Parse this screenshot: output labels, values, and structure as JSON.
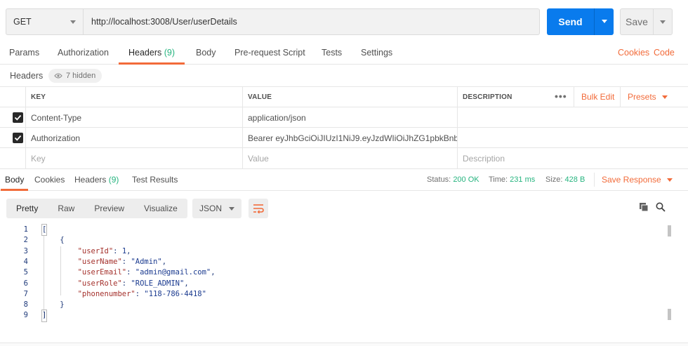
{
  "request": {
    "method": "GET",
    "url": "http://localhost:3008/User/userDetails",
    "send_label": "Send",
    "save_label": "Save"
  },
  "request_tabs": [
    {
      "label": "Params"
    },
    {
      "label": "Authorization"
    },
    {
      "label": "Headers",
      "count": "(9)"
    },
    {
      "label": "Body"
    },
    {
      "label": "Pre-request Script"
    },
    {
      "label": "Tests"
    },
    {
      "label": "Settings"
    }
  ],
  "right_links": {
    "cookies": "Cookies",
    "code": "Code"
  },
  "headers_bar": {
    "title": "Headers",
    "hidden": "7 hidden"
  },
  "table": {
    "columns": {
      "key": "KEY",
      "value": "VALUE",
      "description": "DESCRIPTION"
    },
    "dots": "•••",
    "bulk_edit": "Bulk Edit",
    "presets": "Presets",
    "rows": [
      {
        "key": "Content-Type",
        "value": "application/json",
        "description": ""
      },
      {
        "key": "Authorization",
        "value": "Bearer eyJhbGciOiJIUzI1NiJ9.eyJzdWIiOiJhZG1pbkBnb\\...",
        "description": ""
      }
    ],
    "placeholders": {
      "key": "Key",
      "value": "Value",
      "description": "Description"
    }
  },
  "response_tabs": [
    {
      "label": "Body"
    },
    {
      "label": "Cookies"
    },
    {
      "label": "Headers",
      "count": "(9)"
    },
    {
      "label": "Test Results"
    }
  ],
  "response_status": {
    "status_label": "Status:",
    "status_value": "200 OK",
    "time_label": "Time:",
    "time_value": "231 ms",
    "size_label": "Size:",
    "size_value": "428 B",
    "save_response": "Save Response"
  },
  "view_modes": [
    "Pretty",
    "Raw",
    "Preview",
    "Visualize"
  ],
  "format": "JSON",
  "code_lines": [
    {
      "n": "1",
      "text": "["
    },
    {
      "n": "2",
      "text": "    {"
    },
    {
      "n": "3",
      "key": "\"userId\"",
      "val": "1",
      "type": "n"
    },
    {
      "n": "4",
      "key": "\"userName\"",
      "val": "\"Admin\"",
      "type": "s"
    },
    {
      "n": "5",
      "key": "\"userEmail\"",
      "val": "\"admin@gmail.com\"",
      "type": "s"
    },
    {
      "n": "6",
      "key": "\"userRole\"",
      "val": "\"ROLE_ADMIN\"",
      "type": "s"
    },
    {
      "n": "7",
      "key": "\"phonenumber\"",
      "val": "\"118-786-4418\"",
      "type": "s",
      "last": true
    },
    {
      "n": "8",
      "text": "    }"
    },
    {
      "n": "9",
      "text": "]"
    }
  ],
  "colors": {
    "accent": "#f26b3a",
    "send_blue": "#097bed",
    "success_green": "#26b47f"
  }
}
